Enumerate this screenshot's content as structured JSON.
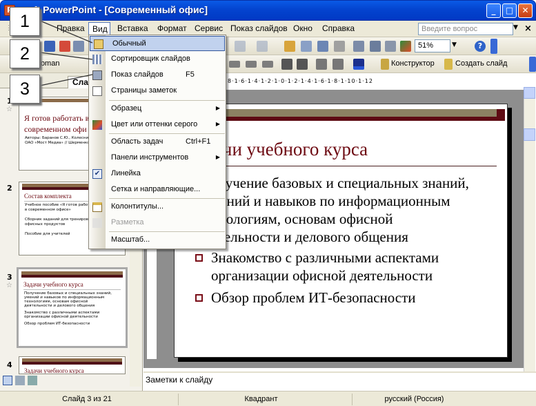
{
  "window": {
    "title": "osoft PowerPoint - [Современный офис]",
    "app_icon": "powerpoint-icon",
    "minimize": "_",
    "maximize": "□",
    "close": "✕"
  },
  "menubar": {
    "items": [
      "Правка",
      "Вид",
      "Вставка",
      "Формат",
      "Сервис",
      "Показ слайдов",
      "Окно",
      "Справка"
    ],
    "help_placeholder": "Введите вопрос",
    "help_arrow": "▼",
    "doc_close": "×"
  },
  "toolbar1": {
    "zoom": "51%",
    "zoom_arrow": "▼",
    "help_glyph": "?"
  },
  "toolbar2": {
    "font_name": "w Roman",
    "constructor_label": "Конструктор",
    "new_slide_label": "Создать слайд"
  },
  "panel": {
    "tab_label": "Слай",
    "close": "×",
    "slides": [
      {
        "num": "1",
        "title": "Я готов работать в современном офи",
        "lines": [
          "Авторы: Баранов С.Ю., Колесников С.Н.,",
          "ОАО «Мост Медиа» // Шерменко И.А."
        ]
      },
      {
        "num": "2",
        "title": "Состав комплекта",
        "lines": [
          "Учебное пособие «Я готов работать",
          "в современном офисе»",
          "Сборник заданий для тренировок",
          "офисных продуктов",
          "Пособие для учителей"
        ]
      },
      {
        "num": "3",
        "title": "Задачи учебного курса",
        "lines": [
          "Получение базовых и специальных знаний,",
          "умений и навыков по информационным",
          "технологиям, основам офисной",
          "деятельности и делового общения",
          "Знакомство с различными аспектами",
          "организации офисной деятельности",
          "Обзор проблем ИТ-безопасности"
        ]
      },
      {
        "num": "4",
        "title": "Задачи учебного курса",
        "lines": []
      }
    ]
  },
  "slide": {
    "title": "ачи учебного курса",
    "bullets": [
      [
        "олучение базовых и специальных знаний,",
        "мений и навыков по информационным",
        "хнологиям, основам офисной",
        "ятельности и делового общения"
      ],
      [
        "Знакомство с различными аспектами",
        "организации офисной деятельности"
      ],
      [
        "Обзор проблем ИТ-безопасности"
      ]
    ]
  },
  "rulers": {
    "horizontal": "8·1·6·1·4·1·2·1·0·1·2·1·4·1·6·1·8·1·10·1·12",
    "vertical": "6·4·2·0·2·4·6·8"
  },
  "notes": {
    "placeholder": "Заметки к слайду"
  },
  "status": {
    "slide_info": "Слайд 3 из 21",
    "design": "Квадрант",
    "language": "русский (Россия)"
  },
  "view_menu": {
    "items": [
      {
        "label": "Обычный",
        "shortcut": "",
        "icon": "normal-view-icon",
        "arrow": false
      },
      {
        "label": "Сортировщик слайдов",
        "shortcut": "",
        "icon": "slide-sorter-icon",
        "arrow": false
      },
      {
        "label": "Показ слайдов",
        "shortcut": "F5",
        "icon": "slideshow-icon",
        "arrow": false
      },
      {
        "label": "Страницы заметок",
        "shortcut": "",
        "icon": "notes-page-icon",
        "arrow": false
      },
      {
        "label": "Образец",
        "shortcut": "",
        "icon": "",
        "arrow": true
      },
      {
        "label": "Цвет или оттенки серого",
        "shortcut": "",
        "icon": "color-grayscale-icon",
        "arrow": true
      },
      {
        "label": "Область задач",
        "shortcut": "Ctrl+F1",
        "icon": "",
        "arrow": false
      },
      {
        "label": "Панели инструментов",
        "shortcut": "",
        "icon": "",
        "arrow": true
      },
      {
        "label": "Линейка",
        "shortcut": "",
        "icon": "checkmark-icon",
        "arrow": false
      },
      {
        "label": "Сетка и направляющие...",
        "shortcut": "",
        "icon": "",
        "arrow": false
      },
      {
        "label": "Колонтитулы...",
        "shortcut": "",
        "icon": "header-footer-icon",
        "arrow": false
      },
      {
        "label": "Разметка",
        "shortcut": "",
        "icon": "markup-icon",
        "arrow": false
      },
      {
        "label": "Масштаб...",
        "shortcut": "",
        "icon": "",
        "arrow": false
      }
    ],
    "submenu_arrow": "▶",
    "check_glyph": "✔"
  },
  "callouts": [
    "1",
    "2",
    "3"
  ],
  "colors": {
    "title_bar": "#0a5ae6",
    "slide_accent": "#6d0a12",
    "menu_highlight": "#c1d2ee"
  }
}
